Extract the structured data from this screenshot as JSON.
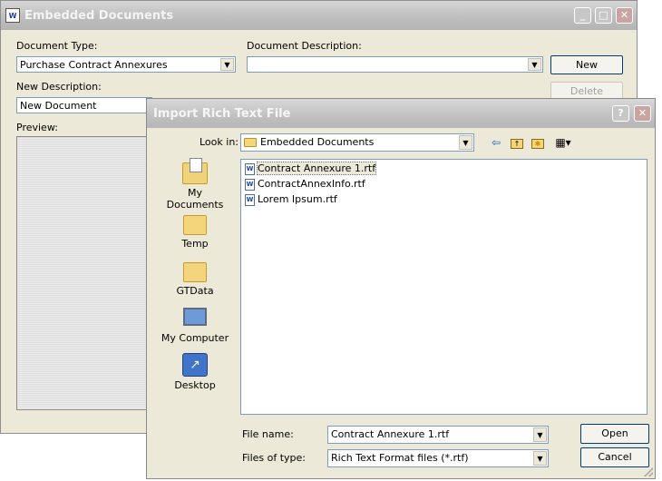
{
  "main_window": {
    "title": "Embedded Documents",
    "controls": {
      "minimize": "_",
      "maximize": "□",
      "close": "✕"
    },
    "document_type_label": "Document Type:",
    "document_type_value": "Purchase Contract Annexures",
    "document_description_label": "Document Description:",
    "document_description_value": "",
    "new_button": "New",
    "new_description_label": "New Description:",
    "new_description_value": "New Document",
    "delete_button": "Delete",
    "preview_label": "Preview:"
  },
  "dialog": {
    "title": "Import Rich Text File",
    "controls": {
      "help": "?",
      "close": "✕"
    },
    "look_in_label": "Look in:",
    "look_in_value": "Embedded Documents",
    "toolbar_icons": [
      "back-icon",
      "up-folder-icon",
      "new-folder-icon",
      "view-menu-icon"
    ],
    "places": [
      {
        "label": "My Documents",
        "icon": "my-documents-icon"
      },
      {
        "label": "Temp",
        "icon": "folder-icon"
      },
      {
        "label": "GTData",
        "icon": "folder-icon"
      },
      {
        "label": "My Computer",
        "icon": "my-computer-icon"
      },
      {
        "label": "Desktop",
        "icon": "desktop-icon"
      }
    ],
    "files": [
      {
        "name": "Contract Annexure 1.rtf",
        "selected": true
      },
      {
        "name": "ContractAnnexInfo.rtf",
        "selected": false
      },
      {
        "name": "Lorem Ipsum.rtf",
        "selected": false
      }
    ],
    "file_name_label": "File name:",
    "file_name_value": "Contract Annexure 1.rtf",
    "files_of_type_label": "Files of type:",
    "files_of_type_value": "Rich Text Format files (*.rtf)",
    "open_button": "Open",
    "cancel_button": "Cancel"
  }
}
